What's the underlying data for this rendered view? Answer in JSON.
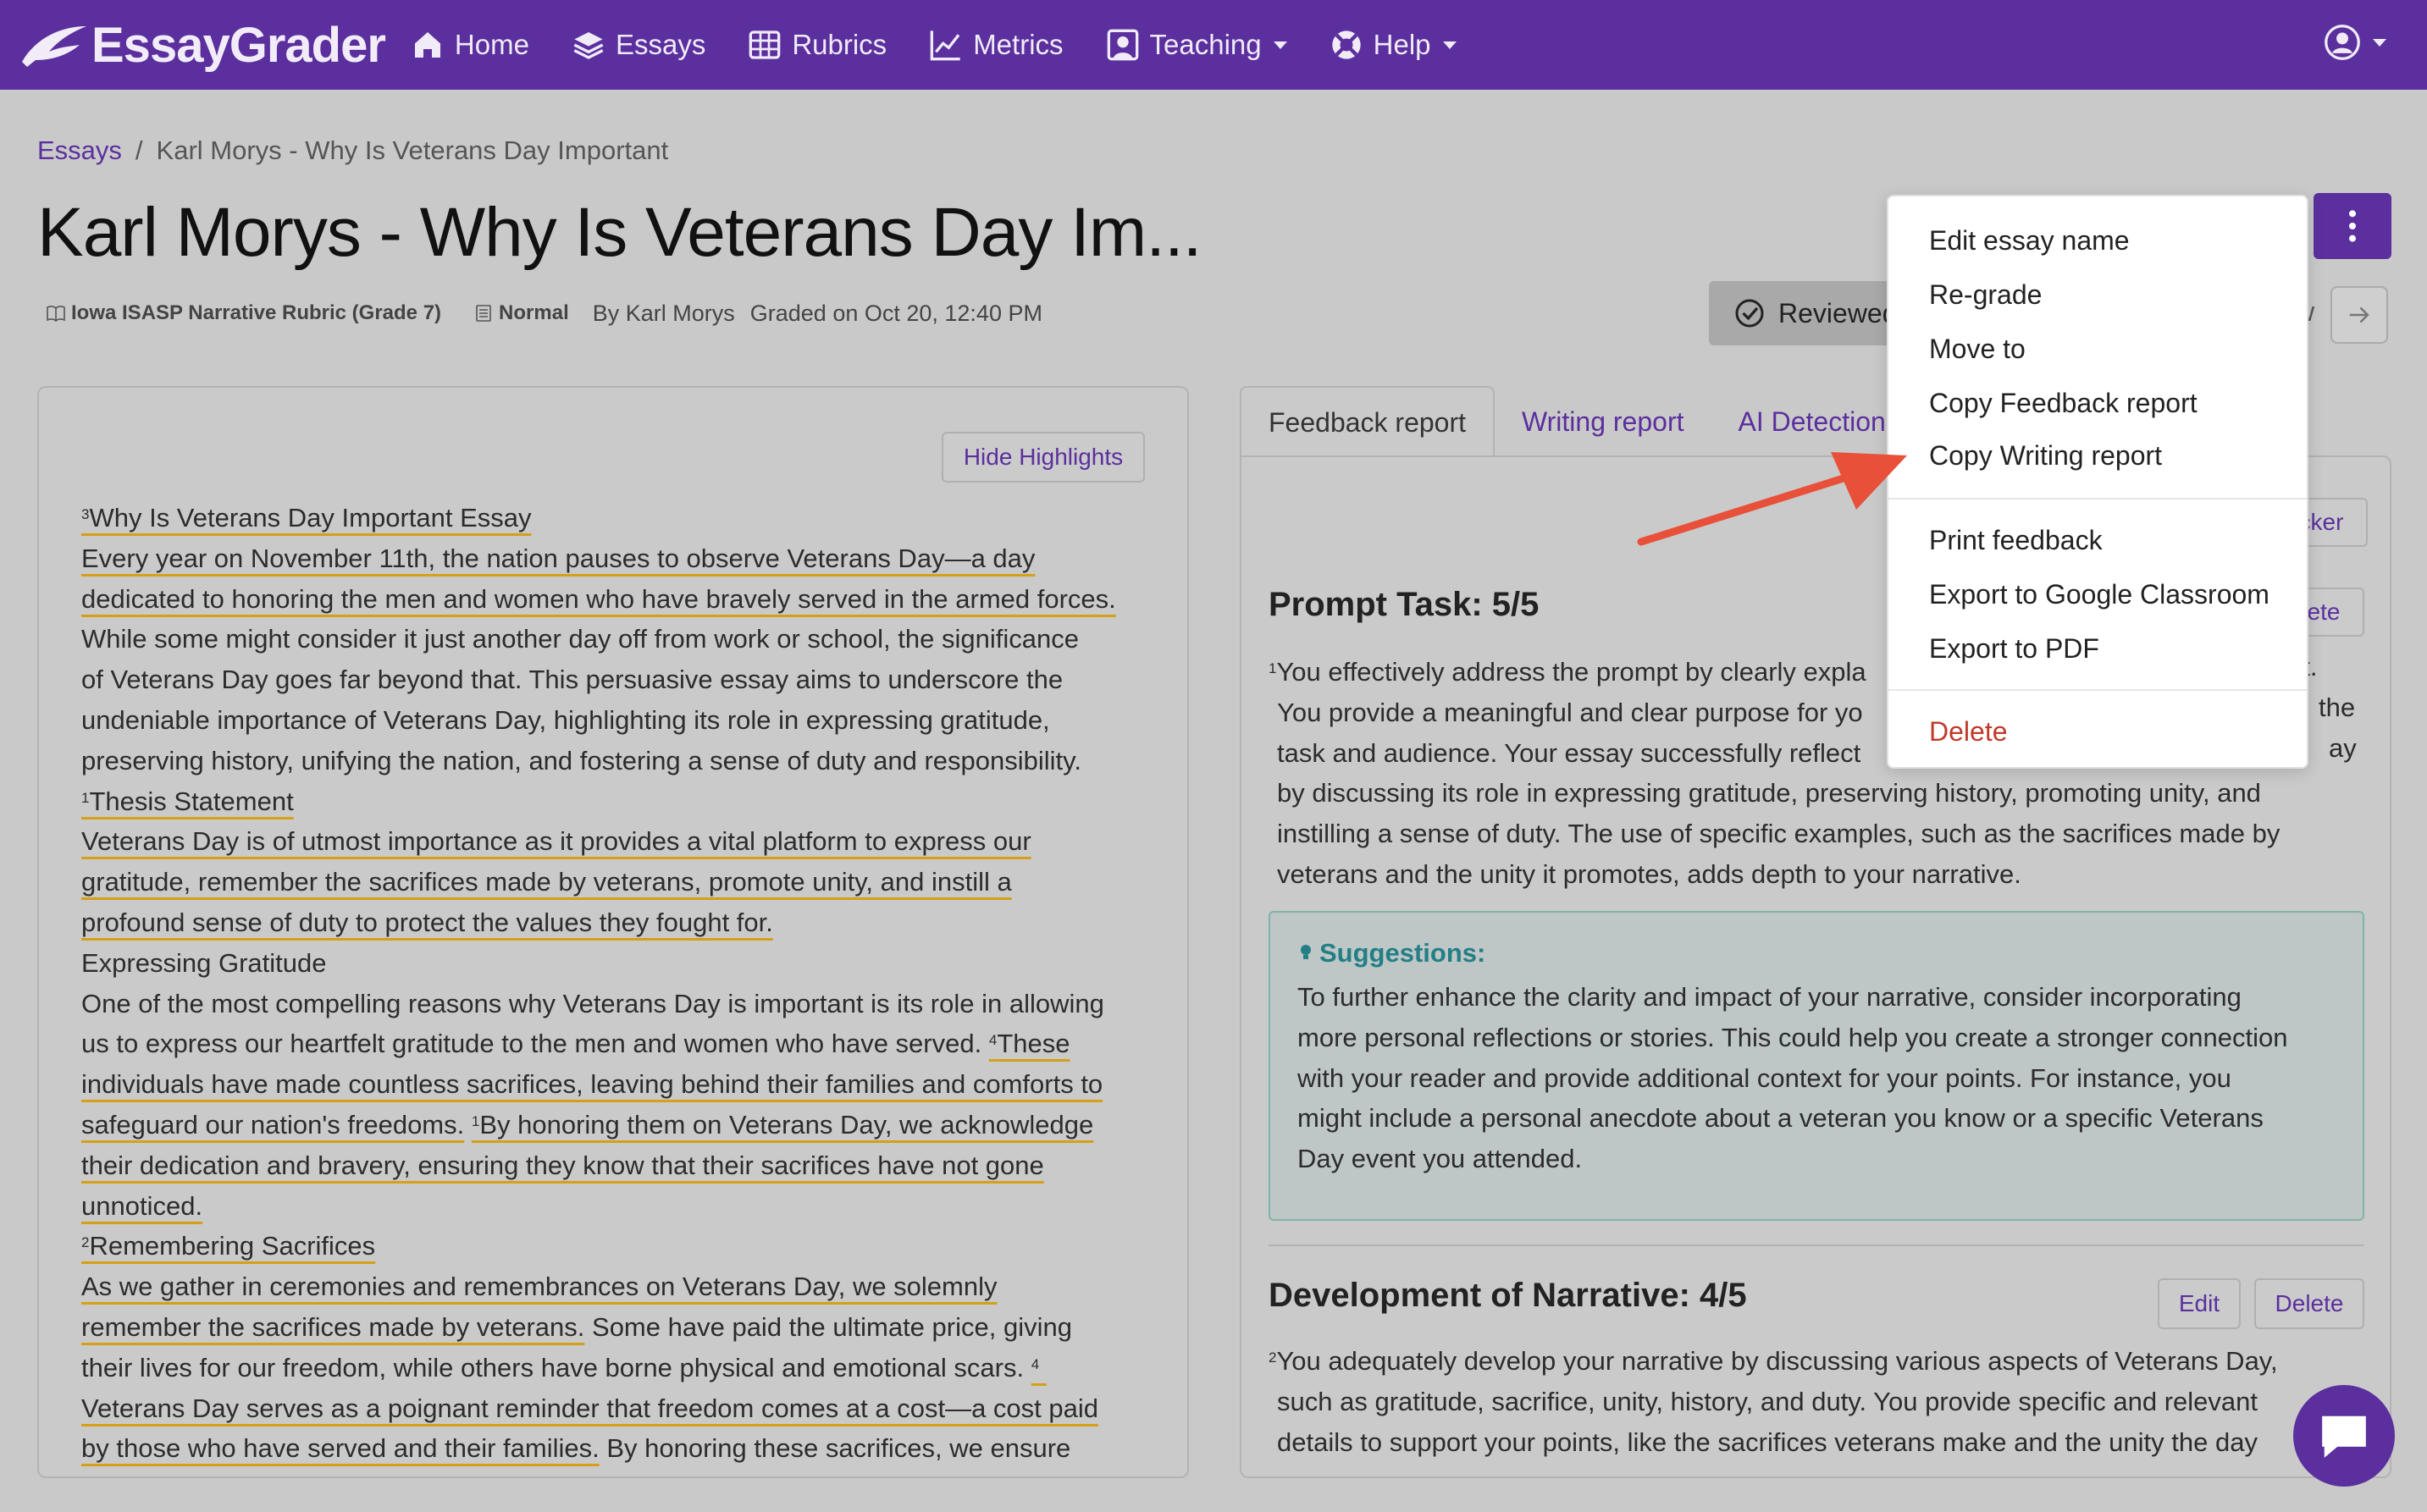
{
  "nav": {
    "brand": "EssayGrader",
    "items": [
      {
        "label": "Home",
        "icon": "home-icon"
      },
      {
        "label": "Essays",
        "icon": "layers-icon"
      },
      {
        "label": "Rubrics",
        "icon": "table-icon"
      },
      {
        "label": "Metrics",
        "icon": "chart-icon"
      },
      {
        "label": "Teaching",
        "icon": "teacher-icon"
      },
      {
        "label": "Help",
        "icon": "lifebuoy-icon"
      }
    ]
  },
  "breadcrumb": {
    "root": "Essays",
    "separator": "/",
    "current": "Karl Morys - Why Is Veterans Day Important"
  },
  "page": {
    "title": "Karl Morys - Why Is Veterans Day Im...",
    "rubric_tag": "Iowa ISASP Narrative Rubric (Grade 7)",
    "mode_tag": "Normal",
    "author": "By Karl Morys",
    "graded": "Graded on Oct 20, 12:40 PM",
    "reviewed_label": "Reviewed",
    "partial_text": "w"
  },
  "essay": {
    "hide_highlights": "Hide Highlights",
    "lines": [
      {
        "sup": "3",
        "text": "Why Is Veterans Day Important Essay",
        "hl": true
      },
      {
        "sup": "",
        "text": "Every year on November 11th, the nation pauses to observe Veterans Day—a day",
        "hl": true
      },
      {
        "sup": "",
        "text": "dedicated to honoring the men and women who have bravely served in the armed forces.",
        "hl": true
      },
      {
        "sup": "",
        "text": "While some might consider it just another day off from work or school, the significance",
        "hl": false
      },
      {
        "sup": "",
        "text": "of Veterans Day goes far beyond that. This persuasive essay aims to underscore the",
        "hl": false
      },
      {
        "sup": "",
        "text": "undeniable importance of Veterans Day, highlighting its role in expressing gratitude,",
        "hl": false
      },
      {
        "sup": "",
        "text": "preserving history, unifying the nation, and fostering a sense of duty and responsibility.",
        "hl": false
      },
      {
        "sup": "1",
        "text": "Thesis Statement",
        "hl": true
      },
      {
        "sup": "",
        "text": "Veterans Day is of utmost importance as it provides a vital platform to express our",
        "hl": true
      },
      {
        "sup": "",
        "text": "gratitude, remember the sacrifices made by veterans, promote unity, and instill a",
        "hl": true
      },
      {
        "sup": "",
        "text": "profound sense of duty to protect the values they fought for.",
        "hl": true
      },
      {
        "sup": "",
        "text": "Expressing Gratitude",
        "hl": false
      }
    ],
    "p_gratitude_1": "One of the most compelling reasons why Veterans Day is important is its role in allowing",
    "p_gratitude_2a": "us to express our heartfelt gratitude to the men and women who have served. ",
    "p_gratitude_2b_sup": "4",
    "p_gratitude_2b": "These",
    "p_gratitude_3": "individuals have made countless sacrifices, leaving behind their families and comforts to",
    "p_gratitude_4a": "safeguard our nation's freedoms.",
    "p_gratitude_4b_sup": "1",
    "p_gratitude_4b": "By honoring them on Veterans Day, we acknowledge",
    "p_gratitude_5": "their dedication and bravery, ensuring they know that their sacrifices have not gone",
    "p_gratitude_6": "unnoticed.",
    "h_remember_sup": "2",
    "h_remember": "Remembering Sacrifices",
    "p_remember_1": "As we gather in ceremonies and remembrances on Veterans Day, we solemnly",
    "p_remember_2a": "remember the sacrifices made by veterans.",
    "p_remember_2b": " Some have paid the ultimate price, giving",
    "p_remember_3": "their lives for our freedom, while others have borne physical and emotional scars. ",
    "p_remember_3_sup": "4",
    "p_remember_4": "Veterans Day serves as a poignant reminder that freedom comes at a cost—a cost paid",
    "p_remember_5a": "by those who have served and their families.",
    "p_remember_5b": " By honoring these sacrifices, we ensure"
  },
  "report": {
    "tabs": [
      "Feedback report",
      "Writing report",
      "AI Detection"
    ],
    "hidden_btn_1": "cker",
    "hidden_btn_2": "ete",
    "s1_heading": "Prompt Task: 5/5",
    "s1_sup": "1",
    "s1_lines": [
      "You effectively address the prompt by clearly expla",
      "You provide a meaningful and clear purpose for yo",
      "task and audience. Your essay successfully reflect",
      "by discussing its role in expressing gratitude, preserving history, promoting unity, and",
      "instilling a sense of duty. The use of specific examples, such as the sacrifices made by",
      "veterans and the unity it promotes, adds depth to your narrative."
    ],
    "s1_right_fragments": [
      "nt.",
      "the",
      "ay"
    ],
    "suggest_title": "Suggestions:",
    "suggest_lines": [
      "To further enhance the clarity and impact of your narrative, consider incorporating",
      "more personal reflections or stories. This could help you create a stronger connection",
      "with your reader and provide additional context for your points. For instance, you",
      "might include a personal anecdote about a veteran you know or a specific Veterans",
      "Day event you attended."
    ],
    "s2_heading": "Development of Narrative: 4/5",
    "edit_label": "Edit",
    "delete_label": "Delete",
    "s2_sup": "2",
    "s2_lines": [
      "You adequately develop your narrative by discussing various aspects of Veterans Day,",
      "such as gratitude, sacrifice, unity, history, and duty. You provide specific and relevant",
      "details to support your points, like the sacrifices veterans make and the unity the day"
    ]
  },
  "menu": {
    "items_top": [
      "Edit essay name",
      "Re-grade",
      "Move to"
    ],
    "items_highlight": [
      "Copy Feedback report",
      "Copy Writing report"
    ],
    "items_bottom": [
      "Print feedback",
      "Export to Google Classroom",
      "Export to PDF"
    ],
    "delete": "Delete"
  },
  "colors": {
    "brand": "#5b2f9e",
    "highlight_underline": "#d5a018",
    "arrow": "#e8503a",
    "danger": "#c0392b",
    "suggest_accent": "#237f86"
  }
}
